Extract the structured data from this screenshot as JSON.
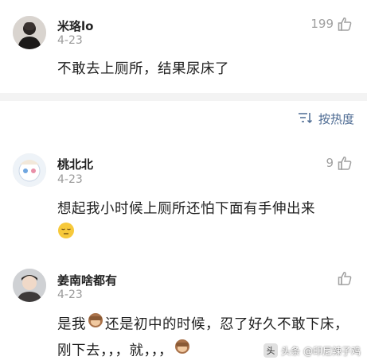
{
  "comments": [
    {
      "username": "米珞lo",
      "date": "4-23",
      "likes": "199",
      "text": "不敢去上厕所，结果尿床了"
    },
    {
      "username": "桃北北",
      "date": "4-23",
      "likes": "9",
      "text": "想起我小时候上厕所还怕下面有手伸出来"
    },
    {
      "username": "姜南啥都有",
      "date": "4-23",
      "likes": "",
      "text_part1": "是我",
      "text_part2": "还是初中的时候，忍了好久不敢下床，刚下去，，，就，，，"
    }
  ],
  "sort": {
    "label": "按热度",
    "icon": "sort-lines-icon"
  },
  "watermark": {
    "prefix": "头条",
    "text": "@印尼辣子鸡",
    "logo_text": "头"
  },
  "colors": {
    "link": "#4c6a92",
    "muted": "#9a9a9a",
    "separator": "#f3f3f3"
  }
}
